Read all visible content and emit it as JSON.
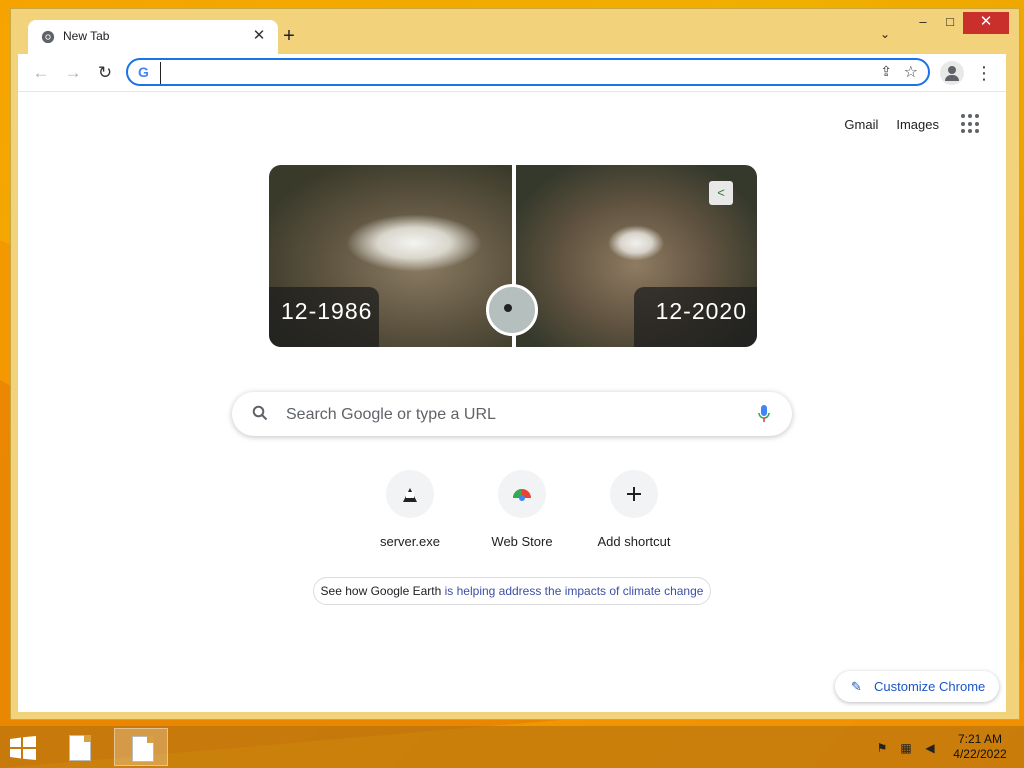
{
  "browser": {
    "tab_title": "New Tab",
    "tab_close": "✕",
    "new_tab": "+",
    "tab_search": "⌄",
    "window_controls": {
      "minimize": "–",
      "maximize": "□",
      "close": "✕"
    },
    "toolbar": {
      "back": "←",
      "forward": "→",
      "reload": "↻",
      "omnibox_value": "",
      "omnibox_g": "G",
      "share_icon": "⇪",
      "star_icon": "☆",
      "menu_icon": "⋮"
    }
  },
  "newtab": {
    "top_links": [
      "Gmail",
      "Images"
    ],
    "doodle": {
      "left_label": "12-1986",
      "right_label": "12-2020"
    },
    "search": {
      "placeholder": "Search Google or type a URL"
    },
    "shortcuts": [
      {
        "label": "server.exe",
        "icon": "server-exe-icon"
      },
      {
        "label": "Web Store",
        "icon": "web-store-icon"
      },
      {
        "label": "Add shortcut",
        "icon": "plus-icon"
      }
    ],
    "earth_link": {
      "prefix": "See how Google Earth ",
      "link_text": "is helping address the impacts of climate change"
    },
    "customize": {
      "label": "Customize Chrome",
      "icon": "pencil-icon"
    }
  },
  "taskbar": {
    "time": "7:21 AM",
    "date": "4/22/2022"
  },
  "colors": {
    "accent": "#1a73e8",
    "desktop": "#f6a300",
    "frame": "#f2d27a"
  }
}
